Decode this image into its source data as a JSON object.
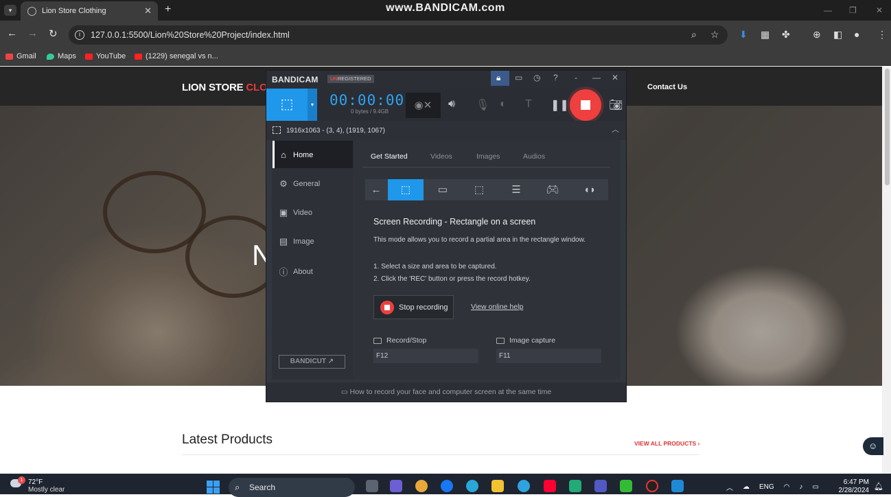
{
  "browser": {
    "tab_title": "Lion Store Clothing",
    "url": "127.0.0.1:5500/Lion%20Store%20Project/index.html",
    "watermark": "www.BANDICAM.com",
    "bookmarks": [
      {
        "label": "Gmail"
      },
      {
        "label": "Maps"
      },
      {
        "label": "YouTube"
      },
      {
        "label": "(1229) senegal vs n..."
      }
    ]
  },
  "site": {
    "brand_white": "LION STORE ",
    "brand_red": "CLO",
    "nav_contact": "Contact Us",
    "hero_fragment": "N",
    "latest_title": "Latest Products",
    "view_all": "VIEW ALL PRODUCTS ›"
  },
  "bandicam": {
    "logo": "BANDICAM",
    "unregistered_un": "UN",
    "unregistered_rest": "REGISTERED",
    "timer": "00:00:00",
    "bytes": "0 bytes / 9.4GB",
    "area": "1916x1063 - (3, 4), (1919, 1067)",
    "sidebar": [
      {
        "label": "Home",
        "icon": "home-icon"
      },
      {
        "label": "General",
        "icon": "gear-icon"
      },
      {
        "label": "Video",
        "icon": "video-icon"
      },
      {
        "label": "Image",
        "icon": "image-icon"
      },
      {
        "label": "About",
        "icon": "info-icon"
      }
    ],
    "bandicut": "BANDICUT",
    "tabs": [
      "Get Started",
      "Videos",
      "Images",
      "Audios"
    ],
    "mode_title": "Screen Recording - Rectangle on a screen",
    "mode_desc": "This mode allows you to record a partial area in the rectangle window.",
    "step1": "1. Select a size and area to be captured.",
    "step2": "2. Click the 'REC' button or press the record hotkey.",
    "stop_label": "Stop recording",
    "help_link": "View online help",
    "hotkeys": {
      "record_label": "Record/Stop",
      "record_key": "F12",
      "capture_label": "Image capture",
      "capture_key": "F11"
    },
    "footer": "How to record your face and computer screen at the same time",
    "accent": "#1f97ea",
    "rec_color": "#ef3f3f"
  },
  "taskbar": {
    "weather_temp": "72°F",
    "weather_desc": "Mostly clear",
    "weather_badge": "1",
    "search": "Search",
    "lang": "ENG",
    "time": "6:47 PM",
    "date": "2/28/2024"
  }
}
